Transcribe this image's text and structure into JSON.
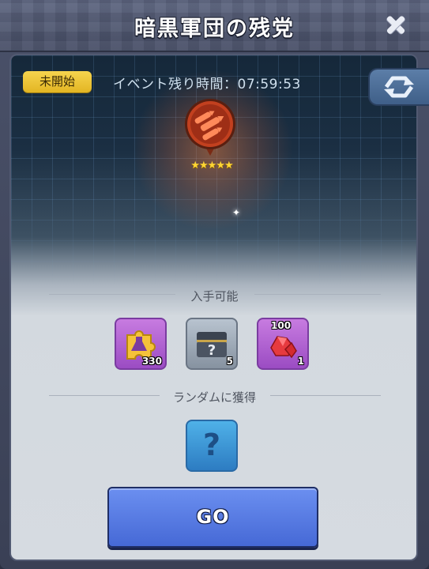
{
  "header": {
    "title": "暗黒軍団の残党",
    "close_icon": "close-icon"
  },
  "status": {
    "badge": "未開始",
    "timer_label": "イベント残り時間：07:59:53"
  },
  "event": {
    "icon": "rocket-squad-icon",
    "stars": "★★★★★",
    "star_count": 5
  },
  "obtainable": {
    "label": "入手可能",
    "items": [
      {
        "icon": "puzzle-flask-icon",
        "count": "330"
      },
      {
        "icon": "mystery-chest-icon",
        "count": "5"
      },
      {
        "icon": "ruby-crystal-icon",
        "top_count": "100",
        "count": "1"
      }
    ]
  },
  "random": {
    "label": "ランダムに獲得",
    "icon": "question-icon",
    "symbol": "?"
  },
  "actions": {
    "go_label": "GO"
  },
  "colors": {
    "accent": "#4669d6",
    "badge": "#e3b523",
    "panel": "#d6dbe1"
  }
}
